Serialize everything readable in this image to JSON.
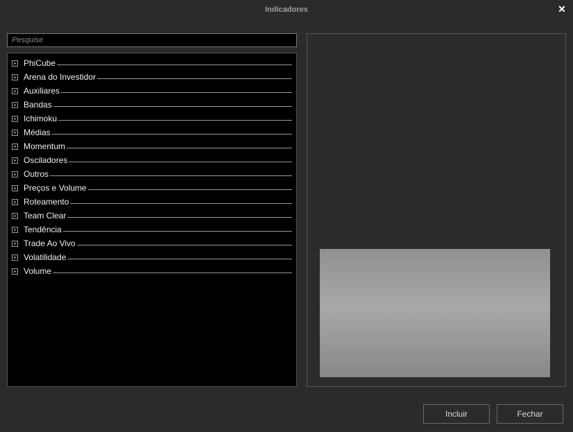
{
  "window": {
    "title": "Indicadores"
  },
  "search": {
    "placeholder": "Pesquise"
  },
  "categories": [
    {
      "label": "PhiCube"
    },
    {
      "label": "Arena do Investidor"
    },
    {
      "label": "Auxiliares"
    },
    {
      "label": "Bandas"
    },
    {
      "label": "Ichimoku"
    },
    {
      "label": "Médias"
    },
    {
      "label": "Momentum"
    },
    {
      "label": "Osciladores"
    },
    {
      "label": "Outros"
    },
    {
      "label": "Preços e Volume"
    },
    {
      "label": "Roteamento"
    },
    {
      "label": "Team Clear"
    },
    {
      "label": "Tendência"
    },
    {
      "label": "Trade Ao Vivo"
    },
    {
      "label": "Volatilidade"
    },
    {
      "label": "Volume"
    }
  ],
  "buttons": {
    "include": "Incluir",
    "close": "Fechar"
  }
}
